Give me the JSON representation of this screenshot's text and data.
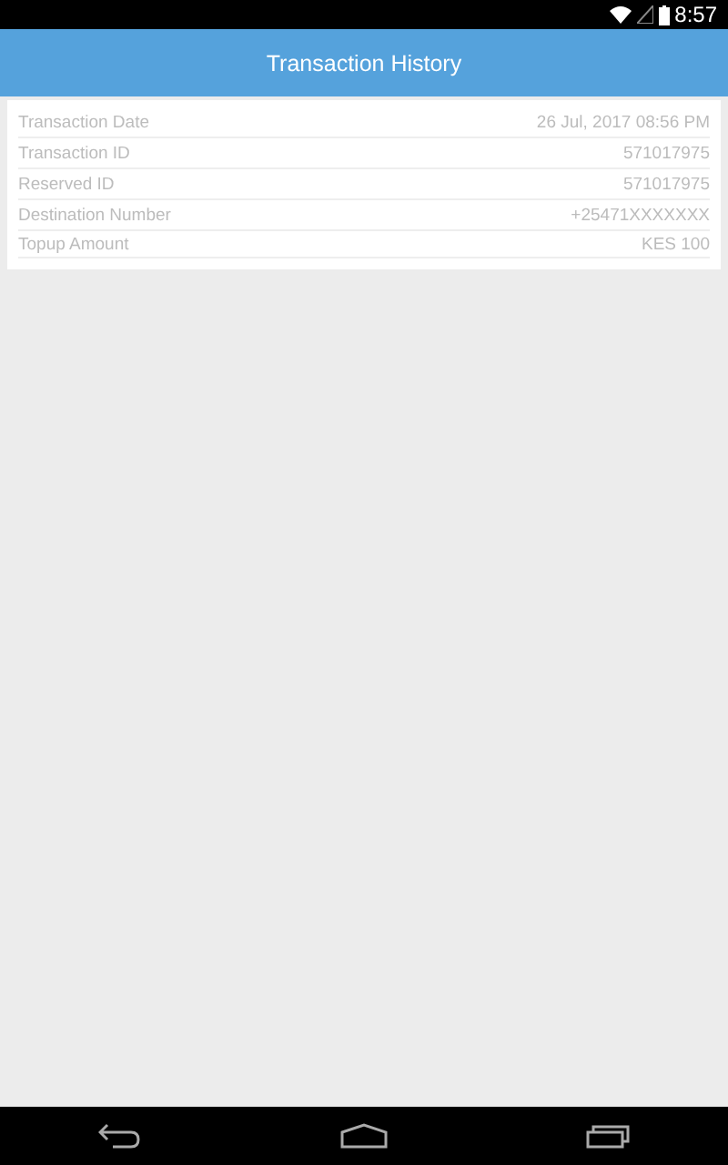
{
  "status_bar": {
    "time": "8:57"
  },
  "app_bar": {
    "title": "Transaction History"
  },
  "details": [
    {
      "label": "Transaction Date",
      "value": "26 Jul, 2017 08:56 PM"
    },
    {
      "label": "Transaction ID",
      "value": "571017975"
    },
    {
      "label": "Reserved ID",
      "value": "571017975"
    },
    {
      "label": "Destination Number",
      "value": "+25471XXXXXXX"
    },
    {
      "label": "Topup Amount",
      "value": "KES 100"
    }
  ]
}
